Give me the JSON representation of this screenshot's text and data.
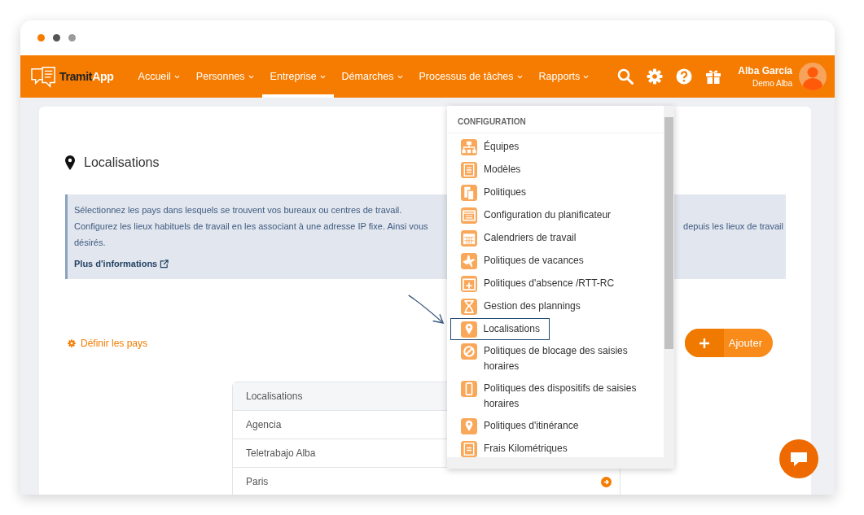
{
  "window_dots": [
    {
      "color": "#f57c00"
    },
    {
      "color": "#555555"
    },
    {
      "color": "#9a9a9a"
    }
  ],
  "nav": {
    "logo": {
      "first": "Tramit",
      "second": "App"
    },
    "items": [
      {
        "label": "Accueil",
        "selected": false
      },
      {
        "label": "Personnes",
        "selected": false
      },
      {
        "label": "Entreprise",
        "selected": true
      },
      {
        "label": "Démarches",
        "selected": false
      },
      {
        "label": "Processus de tâches",
        "selected": false
      },
      {
        "label": "Rapports",
        "selected": false
      }
    ],
    "user": {
      "name": "Alba García",
      "company": "Demo Alba"
    }
  },
  "page": {
    "title": "Localisations",
    "info": {
      "lines": [
        {
          "texts": [
            "Sélectionnez les pays dans lesquels se trouvent vos bureaux ou centres de travail."
          ]
        },
        {
          "texts": [
            "Configurez les lieux habituels de travail en les associant à une adresse IP fixe. Ainsi vous",
            "depuis les lieux de travail"
          ]
        },
        {
          "texts": [
            "désirés."
          ]
        }
      ],
      "link": "Plus d'informations"
    },
    "define_link": "Définir les pays",
    "add_button": "Ajouter",
    "table": {
      "header": "Localisations",
      "rows": [
        "Agencia",
        "Teletrabajo Alba",
        "Paris"
      ]
    }
  },
  "dropdown": {
    "header": "CONFIGURATION",
    "items": [
      {
        "label": "Équipes",
        "highlighted": false
      },
      {
        "label": "Modèles",
        "highlighted": false
      },
      {
        "label": "Politiques",
        "highlighted": false
      },
      {
        "label": "Configuration du planificateur",
        "highlighted": false
      },
      {
        "label": "Calendriers de travail",
        "highlighted": false
      },
      {
        "label": "Politiques de vacances",
        "highlighted": false
      },
      {
        "label": "Politiques d'absence /RTT-RC",
        "highlighted": false
      },
      {
        "label": "Gestion des plannings",
        "highlighted": false
      },
      {
        "label": "Localisations",
        "highlighted": true
      },
      {
        "label": "Politiques de blocage des saisies horaires",
        "highlighted": false
      },
      {
        "label": "Politiques des dispositifs de saisies horaires",
        "highlighted": false
      },
      {
        "label": "Politiques d'itinérance",
        "highlighted": false
      },
      {
        "label": "Frais Kilométriques",
        "highlighted": false
      }
    ]
  }
}
